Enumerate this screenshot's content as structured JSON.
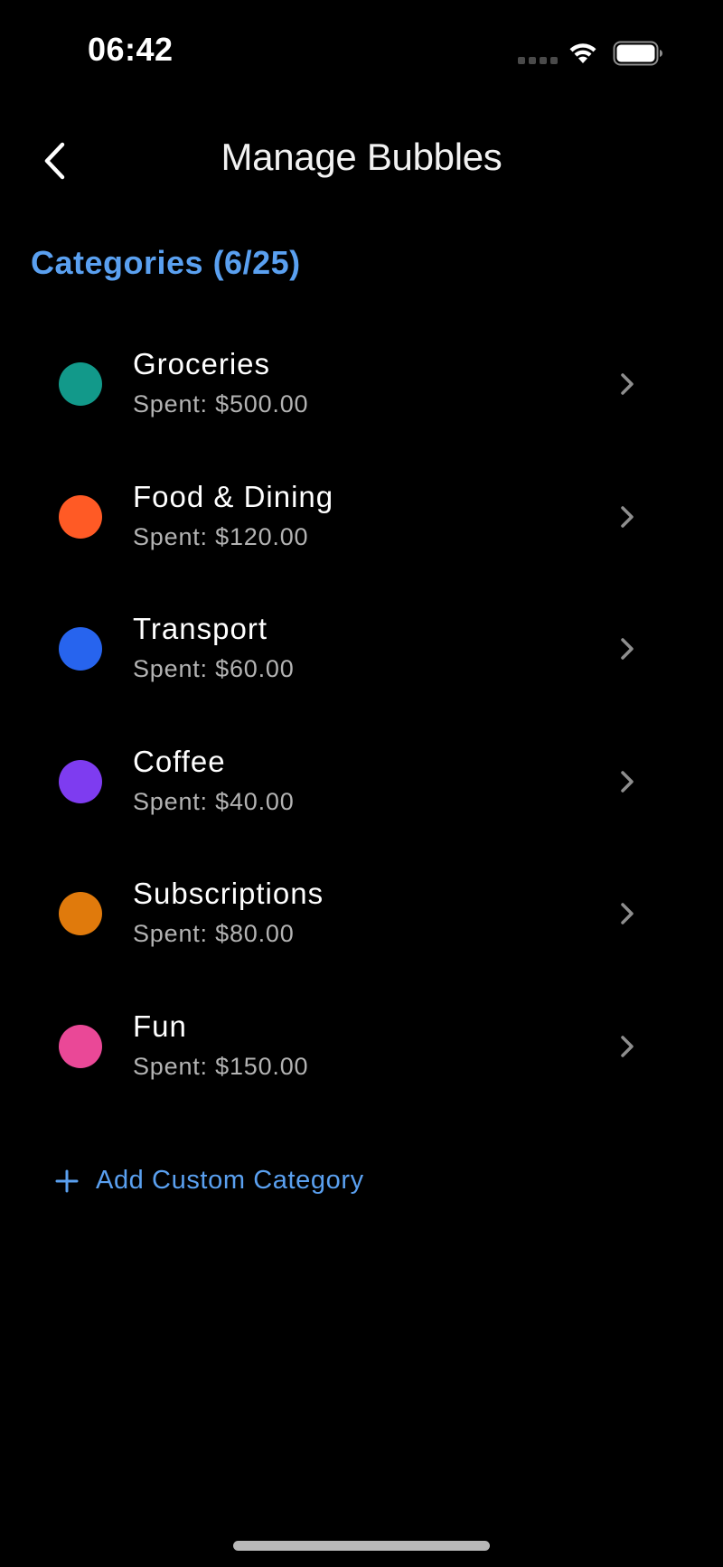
{
  "status_bar": {
    "time": "06:42"
  },
  "nav": {
    "title": "Manage Bubbles"
  },
  "section": {
    "heading": "Categories (6/25)"
  },
  "categories": [
    {
      "name": "Groceries",
      "spent": "Spent: $500.00",
      "color": "#12998a"
    },
    {
      "name": "Food & Dining",
      "spent": "Spent: $120.00",
      "color": "#ff5a25"
    },
    {
      "name": "Transport",
      "spent": "Spent: $60.00",
      "color": "#2764ee"
    },
    {
      "name": "Coffee",
      "spent": "Spent: $40.00",
      "color": "#7e3cf0"
    },
    {
      "name": "Subscriptions",
      "spent": "Spent: $80.00",
      "color": "#e07a0c"
    },
    {
      "name": "Fun",
      "spent": "Spent: $150.00",
      "color": "#ea4897"
    }
  ],
  "add_button": {
    "label": "Add Custom Category"
  },
  "colors": {
    "accent": "#5aa0f0",
    "background": "#000000",
    "secondary_text": "#b3b3b3"
  },
  "icons": {
    "back": "chevron-left-icon",
    "row_chevron": "chevron-right-icon",
    "add": "plus-icon",
    "wifi": "wifi-icon",
    "battery": "battery-icon"
  }
}
